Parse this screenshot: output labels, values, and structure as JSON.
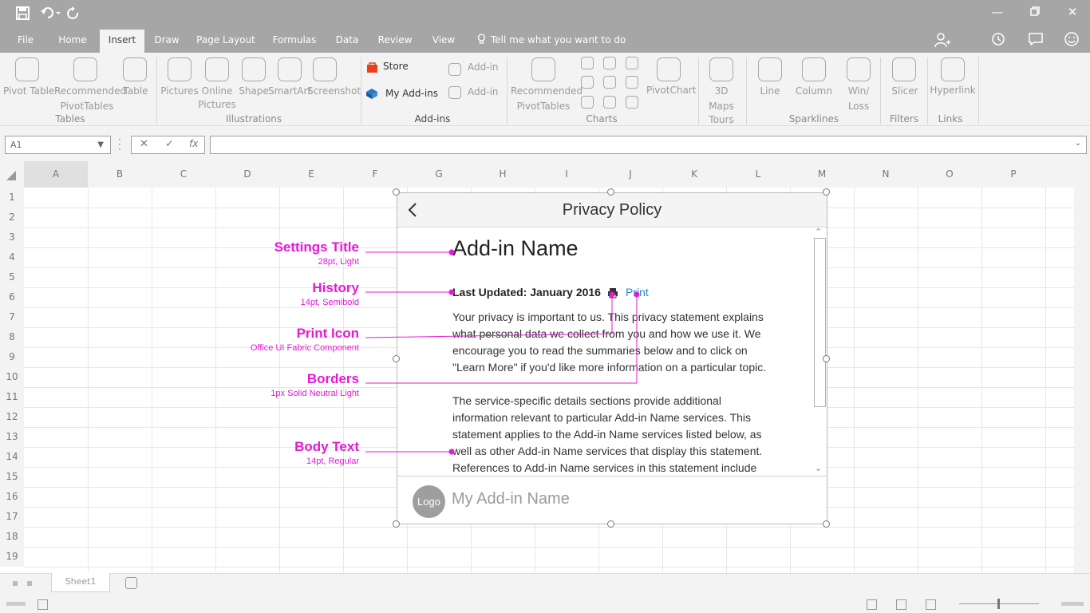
{
  "tabs": [
    "File",
    "Home",
    "Insert",
    "Draw",
    "Page Layout",
    "Formulas",
    "Data",
    "Review",
    "View"
  ],
  "active_tab": "Insert",
  "tell_me": "Tell me what you want to do",
  "ribbon": {
    "tables": {
      "pivot_table": "Pivot Table",
      "recommended_l1": "Recommended",
      "recommended_l2": "PivotTables",
      "table": "Table",
      "group": "Tables"
    },
    "illustrations": {
      "pictures": "Pictures",
      "online_l1": "Online",
      "online_l2": "Pictures",
      "shape": "Shape",
      "smartart": "SmartArt",
      "screenshot": "Screenshot",
      "group": "Illustrations"
    },
    "addins": {
      "store": "Store",
      "my_addins": "My Add-ins",
      "addin_1": "Add-in",
      "addin_2": "Add-in",
      "group": "Add-ins"
    },
    "charts": {
      "recommended_l1": "Recommended",
      "recommended_l2": "PivotTables",
      "pivotchart": "PivotChart",
      "group": "Charts"
    },
    "tours": {
      "l1": "3D",
      "l2": "Maps",
      "l3": "Tours"
    },
    "sparklines": {
      "line": "Line",
      "column": "Column",
      "winloss_l1": "Win/",
      "winloss_l2": "Loss",
      "group": "Sparklines"
    },
    "filters": {
      "slicer": "Slicer",
      "group": "Filters"
    },
    "links": {
      "hyperlink": "Hyperlink",
      "group": "Links"
    }
  },
  "formula_bar": {
    "name_box": "A1",
    "fx": "fx"
  },
  "columns": [
    "A",
    "B",
    "C",
    "D",
    "E",
    "F",
    "G",
    "H",
    "I",
    "J",
    "K",
    "L",
    "M",
    "N",
    "O",
    "P"
  ],
  "rows": [
    "1",
    "2",
    "3",
    "4",
    "5",
    "6",
    "7",
    "8",
    "9",
    "10",
    "11",
    "12",
    "13",
    "14",
    "15",
    "16",
    "17",
    "18",
    "19"
  ],
  "sheet_tab": "Sheet1",
  "pane": {
    "title": "Privacy Policy",
    "addin_name": "Add-in Name",
    "history": "Last Updated: January 2016",
    "print": "Print",
    "body_1": "Your privacy is important to us. This privacy statement explains what personal data we collect from you and how we use it. We encourage you to read the summaries below and to click on \"Learn More\" if you'd like more information on a particular topic.",
    "body_2": "The service-specific details sections provide additional information relevant to particular Add-in Name services. This statement applies to the Add-in Name services listed below, as well as other Add-in Name services that display this statement. References to Add-in Name services in this statement include",
    "logo": "Logo",
    "footer_name": "My Add-in Name"
  },
  "annotations": [
    {
      "title": "Settings Title",
      "sub": "28pt, Light"
    },
    {
      "title": "History",
      "sub": "14pt, Semibold"
    },
    {
      "title": "Print Icon",
      "sub": "Office UI  Fabric Component"
    },
    {
      "title": "Borders",
      "sub": "1px Solid Neutral Light"
    },
    {
      "title": "Body Text",
      "sub": "14pt, Regular"
    }
  ],
  "colors": {
    "annotation": "#e619d6",
    "link": "#2b88d8",
    "chrome": "#a6a6a6"
  }
}
